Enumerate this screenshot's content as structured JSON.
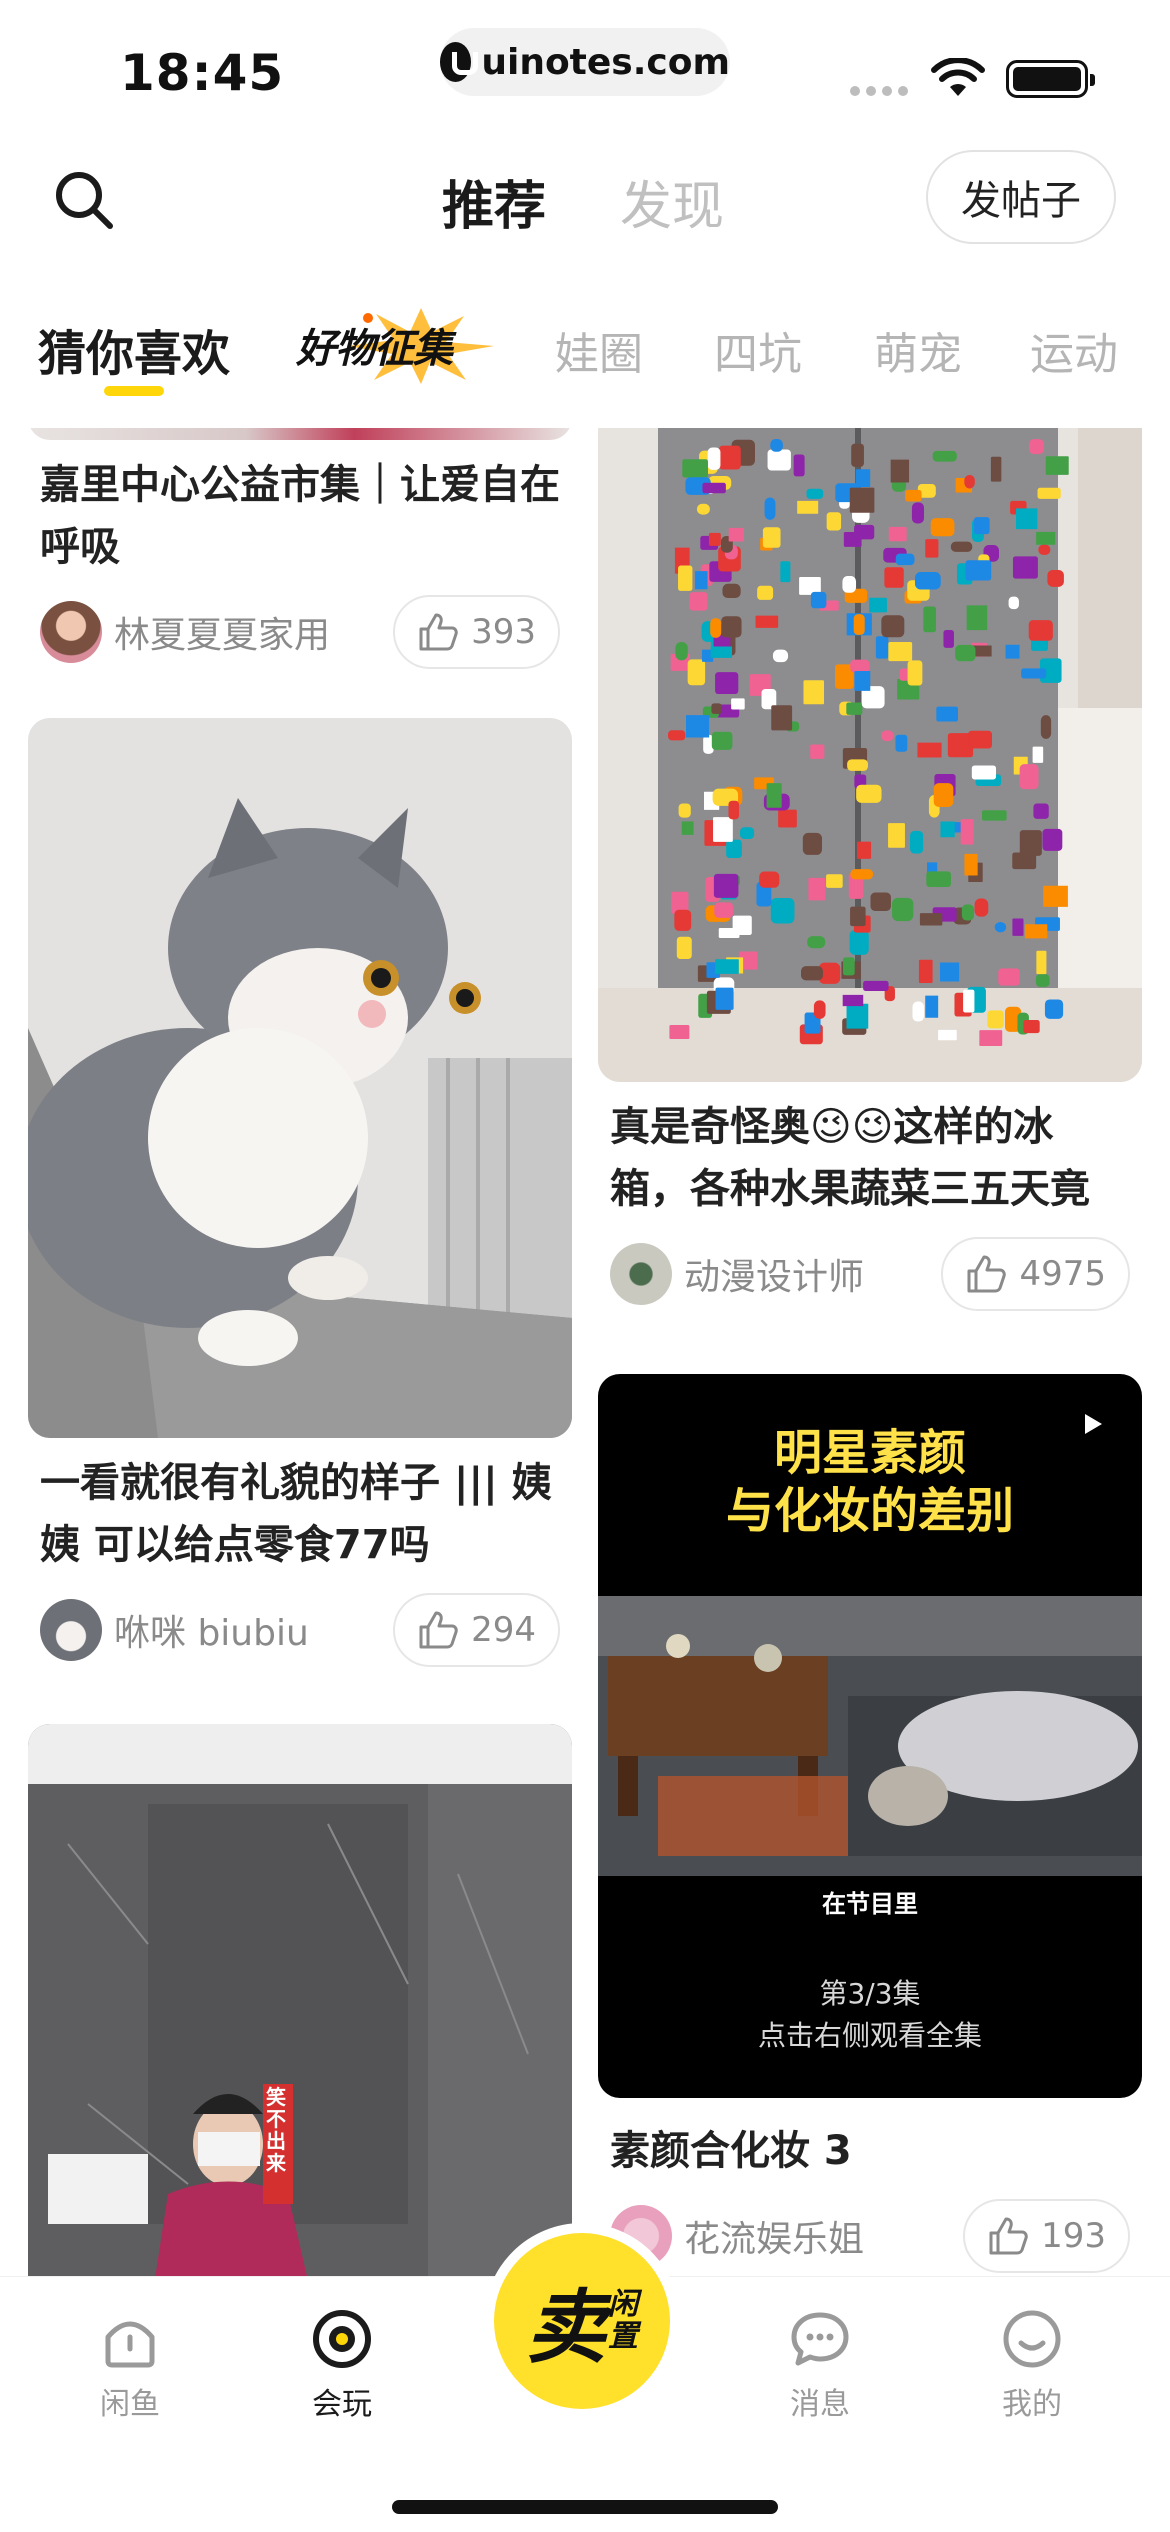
{
  "status_bar": {
    "time": "18:45",
    "url": "uinotes.com"
  },
  "header": {
    "tabs": [
      {
        "label": "推荐",
        "active": true
      },
      {
        "label": "发现",
        "active": false
      }
    ],
    "post_button": "发帖子",
    "icons": {
      "search": "search-icon"
    }
  },
  "categories": {
    "items": [
      "猜你喜欢",
      "好物征集",
      "娃圈",
      "四坑",
      "萌宠",
      "运动"
    ],
    "accent": "#ffd60a"
  },
  "feed": {
    "left": [
      {
        "title": "嘉里中心公益市集｜让爱自在呼吸",
        "author": "林夏夏夏家用",
        "likes": "393"
      },
      {
        "title": "一看就很有礼貌的样子 ||| 姨姨 可以给点零食77吗",
        "author": "咻咪 biubiu",
        "likes": "294"
      },
      {
        "image_text": "笑不出来"
      }
    ],
    "right": [
      {
        "title": "真是奇怪奥😉😉这样的冰箱，各种水果蔬菜三五天竟",
        "author": "动漫设计师",
        "likes": "4975"
      },
      {
        "video_title": "明星素颜\n与化妆的差别",
        "caption": "在节目里",
        "episode": "第3/3集",
        "hint": "点击右侧观看全集",
        "title": "素颜合化妆 3",
        "author": "花流娱乐姐",
        "likes": "193"
      }
    ]
  },
  "bottom_nav": {
    "items": [
      {
        "label": "闲鱼",
        "icon": "home-icon",
        "active": false
      },
      {
        "label": "会玩",
        "icon": "play-circle-icon",
        "active": true
      },
      {
        "label": "消息",
        "icon": "message-icon",
        "active": false
      },
      {
        "label": "我的",
        "icon": "profile-icon",
        "active": false
      }
    ],
    "sell": {
      "main": "卖",
      "sub1": "闲",
      "sub2": "置"
    },
    "sell_color": "#ffe02a"
  }
}
